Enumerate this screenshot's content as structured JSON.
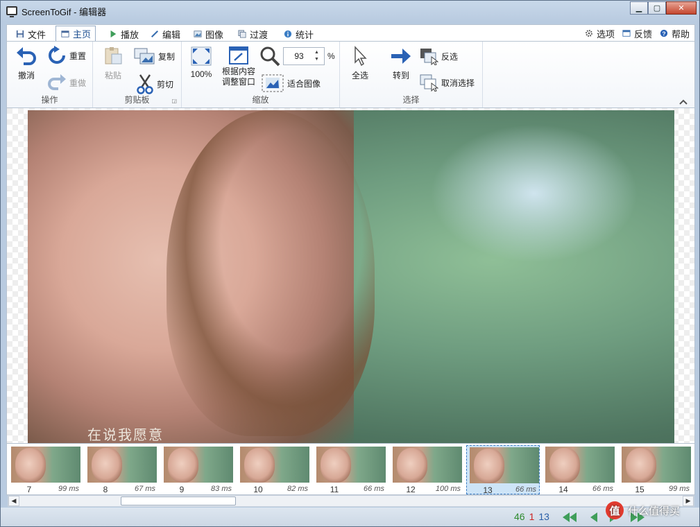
{
  "window": {
    "title": "ScreenToGif - 编辑器"
  },
  "tabs": [
    {
      "label": "文件"
    },
    {
      "label": "主页"
    },
    {
      "label": "播放"
    },
    {
      "label": "编辑"
    },
    {
      "label": "图像"
    },
    {
      "label": "过渡"
    },
    {
      "label": "统计"
    }
  ],
  "tabs_right": {
    "options": "选项",
    "feedback": "反馈",
    "help": "帮助"
  },
  "ribbon": {
    "actions": {
      "undo": "撤消",
      "reset": "重置",
      "redo": "重做",
      "label": "操作"
    },
    "clipboard": {
      "paste": "粘贴",
      "copy": "复制",
      "cut": "剪切",
      "label": "剪贴板"
    },
    "zoom": {
      "zoom100": "100%",
      "fit_window_line1": "根据内容",
      "fit_window_line2": "调整窗口",
      "zoom_value": "93",
      "percent": "%",
      "fit_image": "适合图像",
      "label": "缩放"
    },
    "select": {
      "select_all": "全选",
      "go_to": "转到",
      "invert": "反选",
      "deselect": "取消选择",
      "label": "选择"
    }
  },
  "image": {
    "subtitle": "在说我愿意"
  },
  "frames": [
    {
      "num": "7",
      "ms": "99 ms"
    },
    {
      "num": "8",
      "ms": "67 ms"
    },
    {
      "num": "9",
      "ms": "83 ms"
    },
    {
      "num": "10",
      "ms": "82 ms"
    },
    {
      "num": "11",
      "ms": "66 ms"
    },
    {
      "num": "12",
      "ms": "100 ms"
    },
    {
      "num": "13",
      "ms": "66 ms"
    },
    {
      "num": "14",
      "ms": "66 ms"
    },
    {
      "num": "15",
      "ms": "99 ms"
    }
  ],
  "selected_frame": "13",
  "status": {
    "total": "46",
    "selected_count": "1",
    "current": "13"
  },
  "watermark": {
    "badge": "值",
    "text": "什么值得买"
  },
  "colors": {
    "accent": "#3a7cc4",
    "total_green": "#2e8b2e",
    "selected_red": "#cc2222",
    "current_blue": "#2a5fa8",
    "nav_green": "#3f9e5a"
  }
}
